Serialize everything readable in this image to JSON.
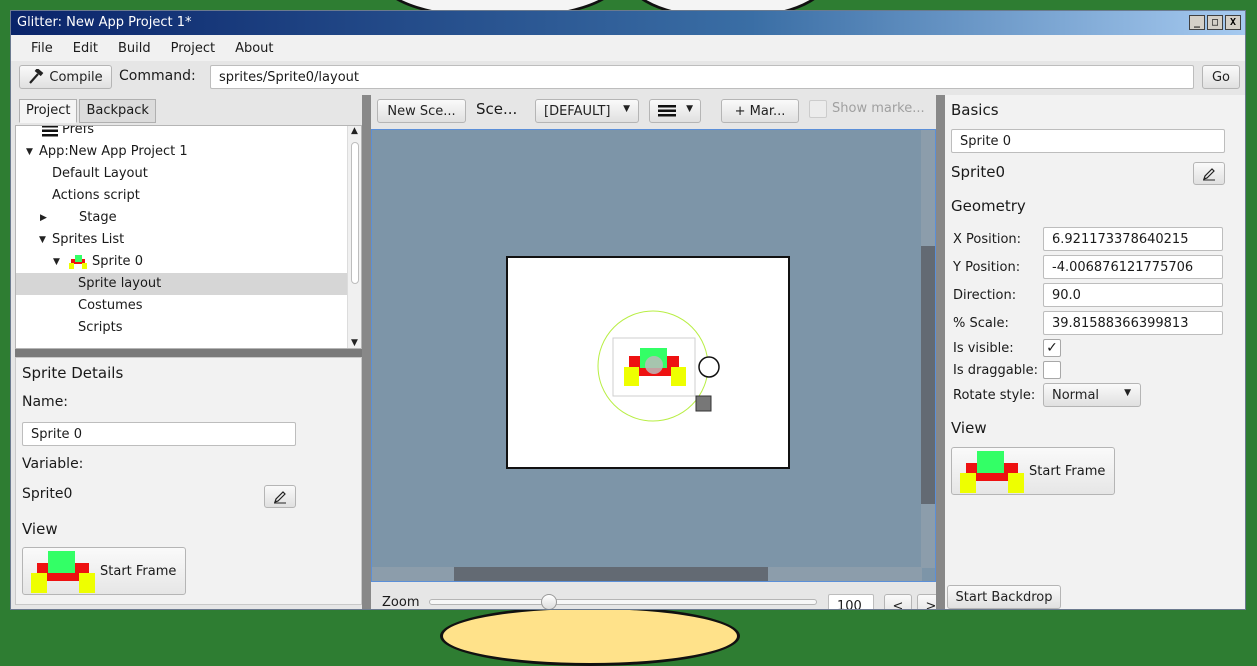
{
  "window": {
    "title": "Glitter: New App Project 1*",
    "controls": [
      "_",
      "□",
      "X"
    ]
  },
  "menu": [
    "File",
    "Edit",
    "Build",
    "Project",
    "About"
  ],
  "command_bar": {
    "compile_label": "Compile",
    "command_label": "Command:",
    "command_value": "sprites/Sprite0/layout",
    "go_label": "Go"
  },
  "left_tabs": [
    "Project",
    "Backpack"
  ],
  "tree": [
    {
      "label": "Prefs",
      "indent": 1,
      "toggle": "none"
    },
    {
      "label": "App:New App Project 1",
      "indent": 0,
      "toggle": "expanded"
    },
    {
      "label": "Default Layout",
      "indent": 1,
      "toggle": "none"
    },
    {
      "label": "Actions script",
      "indent": 1,
      "toggle": "none"
    },
    {
      "label": "Stage",
      "indent": 1,
      "toggle": "collapsed"
    },
    {
      "label": "Sprites List",
      "indent": 1,
      "toggle": "expanded"
    },
    {
      "label": "Sprite 0",
      "indent": 2,
      "toggle": "expanded"
    },
    {
      "label": "Sprite layout",
      "indent": 3,
      "toggle": "none"
    },
    {
      "label": "Costumes",
      "indent": 3,
      "toggle": "none"
    },
    {
      "label": "Scripts",
      "indent": 3,
      "toggle": "none"
    }
  ],
  "sprite_details": {
    "title": "Sprite Details",
    "name_label": "Name:",
    "name_value": "Sprite 0",
    "variable_label": "Variable:",
    "variable_value": "Sprite0",
    "view_label": "View",
    "costume_label": "Start Frame"
  },
  "scene_toolbar": {
    "new_scene_label": "New Sce...",
    "scene_label": "Sce...",
    "layout_select": "[DEFAULT]",
    "add_marker_label": "+ Mar...",
    "show_markers_label": "Show marke..."
  },
  "zoom": {
    "label": "Zoom",
    "value": "100",
    "prev": "<",
    "next": ">",
    "level": 0.3
  },
  "basics": {
    "title": "Basics",
    "name_value": "Sprite 0",
    "variable_value": "Sprite0",
    "geometry_title": "Geometry",
    "x_label": "X Position:",
    "x_value": "6.921173378640215",
    "y_label": "Y Position:",
    "y_value": "-4.006876121775706",
    "direction_label": "Direction:",
    "direction_value": "90.0",
    "scale_label": "% Scale:",
    "scale_value": "39.81588366399813",
    "visible_label": "Is visible:",
    "visible_checked": true,
    "draggable_label": "Is draggable:",
    "draggable_checked": false,
    "rotate_label": "Rotate style:",
    "rotate_value": "Normal",
    "view_title": "View",
    "costume_label": "Start Frame"
  },
  "start_backdrop_label": "Start Backdrop",
  "colors": {
    "sprite_green": "#33ff66",
    "sprite_red": "#ee1111",
    "sprite_yellow": "#eeff00",
    "canvas_bg": "#7d95a8",
    "titlebar": "#0a246a"
  }
}
